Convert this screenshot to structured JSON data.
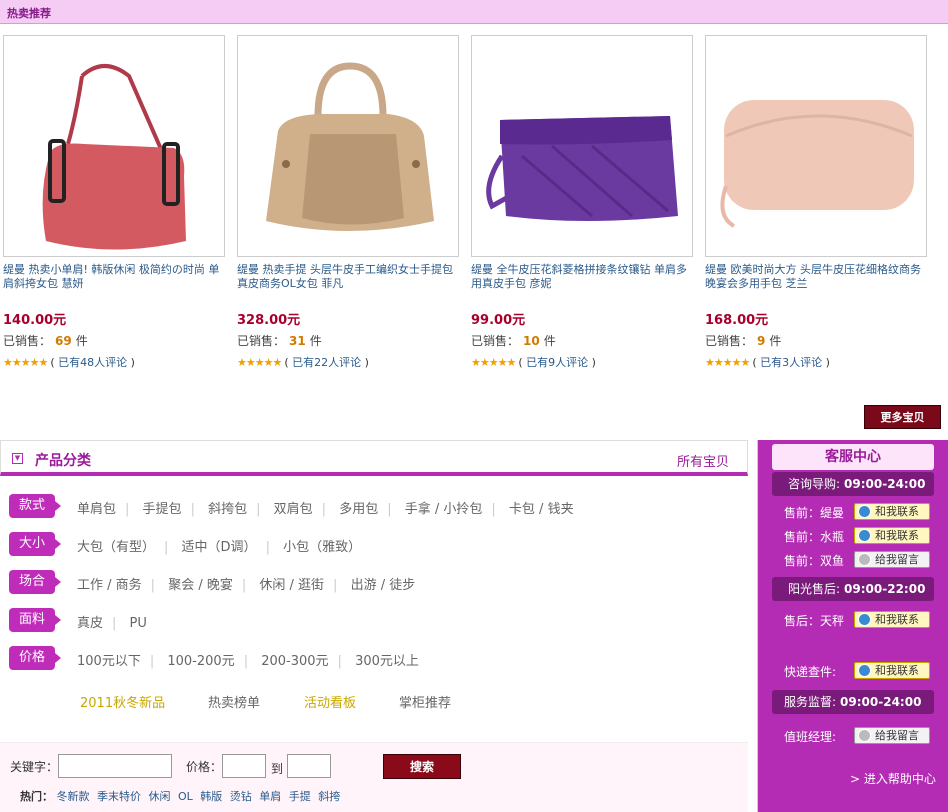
{
  "hot_header": "热卖推荐",
  "products": [
    {
      "name": "缇曼 热卖小单肩! 韩版休闲 极简约の时尚 单肩斜挎女包 慧妍",
      "price": "140.00元",
      "sold_label": "已销售：",
      "sold_count": "69",
      "sold_unit": "件",
      "stars": "★★★★★",
      "review_open": "(",
      "review_text": "已有48人评论",
      "review_close": ")"
    },
    {
      "name": "缇曼 热卖手提 头层牛皮手工编织女士手提包 真皮商务OL女包 菲凡",
      "price": "328.00元",
      "sold_label": "已销售：",
      "sold_count": "31",
      "sold_unit": "件",
      "stars": "★★★★★",
      "review_open": "(",
      "review_text": "已有22人评论",
      "review_close": ")"
    },
    {
      "name": "缇曼 全牛皮压花斜菱格拼接条纹镶钻 单肩多用真皮手包 彦妮",
      "price": "99.00元",
      "sold_label": "已销售：",
      "sold_count": "10",
      "sold_unit": "件",
      "stars": "★★★★★",
      "review_open": "(",
      "review_text": "已有9人评论",
      "review_close": ")"
    },
    {
      "name": "缇曼 欧美时尚大方 头层牛皮压花细格纹商务晚宴会多用手包 芝兰",
      "price": "168.00元",
      "sold_label": "已销售：",
      "sold_count": "9",
      "sold_unit": "件",
      "stars": "★★★★★",
      "review_open": "(",
      "review_text": "已有3人评论",
      "review_close": ")"
    }
  ],
  "more_button": "更多宝贝",
  "category": {
    "title": "产品分类",
    "all_link": "所有宝贝",
    "rows": [
      {
        "tag": "款式",
        "items": [
          "单肩包",
          "手提包",
          "斜挎包",
          "双肩包",
          "多用包",
          "手拿 / 小拎包",
          "卡包 / 钱夹"
        ]
      },
      {
        "tag": "大小",
        "items": [
          "大包（有型）",
          "适中（D调）",
          "小包（雅致）"
        ]
      },
      {
        "tag": "场合",
        "items": [
          "工作 / 商务",
          "聚会 / 晚宴",
          "休闲 / 逛街",
          "出游 / 徒步"
        ]
      },
      {
        "tag": "面料",
        "items": [
          "真皮",
          "PU"
        ]
      },
      {
        "tag": "价格",
        "items": [
          "100元以下",
          "100-200元",
          "200-300元",
          "300元以上"
        ]
      }
    ],
    "highlights": [
      "2011秋冬新品",
      "热卖榜单",
      "活动看板",
      "掌柜推荐"
    ]
  },
  "search": {
    "keyword_label": "关键字：",
    "price_label": "价格：",
    "to_label": "到",
    "button": "搜索",
    "hot_label": "热门：",
    "hot_terms": [
      "冬新款",
      "季末特价",
      "休闲",
      "OL",
      "韩版",
      "烫钻",
      "单肩",
      "手提",
      "斜挎"
    ]
  },
  "service": {
    "title": "客服中心",
    "consult_label": "咨询导购:",
    "consult_time": "09:00-24:00",
    "presale": [
      {
        "label": "售前：缇曼",
        "btn": "和我联系"
      },
      {
        "label": "售前：水瓶",
        "btn": "和我联系"
      },
      {
        "label": "售前：双鱼",
        "btn": "给我留言"
      }
    ],
    "after_label": "阳光售后:",
    "after_time": "09:00-22:00",
    "after": {
      "label": "售后：天秤",
      "btn": "和我联系"
    },
    "express": {
      "label": "快递查件:",
      "btn": "和我联系"
    },
    "monitor_label": "服务监督:",
    "monitor_time": "09:00-24:00",
    "manager": {
      "label": "值班经理:",
      "btn": "给我留言"
    },
    "help": "> 进入帮助中心"
  },
  "colors": {
    "accent": "#b42cb4",
    "price": "#a8002a",
    "button": "#7a0a1a"
  }
}
